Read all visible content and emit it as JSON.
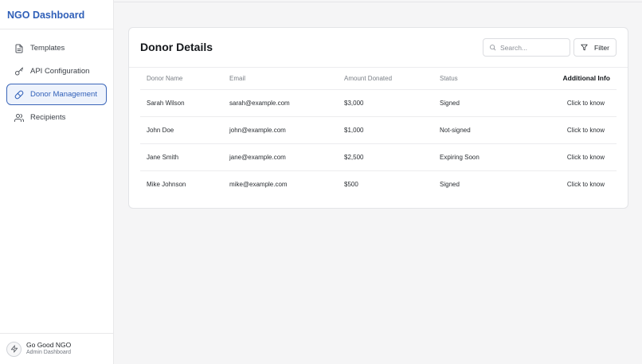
{
  "sidebar": {
    "brand": "NGO Dashboard",
    "items": [
      {
        "label": "Templates",
        "icon": "document-icon",
        "active": false
      },
      {
        "label": "API Configuration",
        "icon": "key-icon",
        "active": false
      },
      {
        "label": "Donor Management",
        "icon": "pill-icon",
        "active": true
      },
      {
        "label": "Recipients",
        "icon": "users-icon",
        "active": false
      }
    ],
    "footer": {
      "org_name": "Go Good NGO",
      "org_role": "Admin Dashboard",
      "icon": "lightning-icon"
    }
  },
  "main": {
    "title": "Donor Details",
    "search": {
      "placeholder": "Search...",
      "value": ""
    },
    "filter_label": "Filter",
    "table": {
      "columns": [
        "Donor Name",
        "Email",
        "Amount Donated",
        "Status",
        "Additional Info"
      ],
      "rows": [
        {
          "name": "Sarah Wilson",
          "email": "sarah@example.com",
          "amount": "$3,000",
          "status": "Signed",
          "info": "Click to know"
        },
        {
          "name": "John Doe",
          "email": "john@example.com",
          "amount": "$1,000",
          "status": "Not-signed",
          "info": "Click to know"
        },
        {
          "name": "Jane Smith",
          "email": "jane@example.com",
          "amount": "$2,500",
          "status": "Expiring Soon",
          "info": "Click to know"
        },
        {
          "name": "Mike Johnson",
          "email": "mike@example.com",
          "amount": "$500",
          "status": "Signed",
          "info": "Click to know"
        }
      ]
    }
  },
  "colors": {
    "accent": "#2f5fb8",
    "active_bg": "#eef3fc",
    "background": "#f5f5f6"
  }
}
